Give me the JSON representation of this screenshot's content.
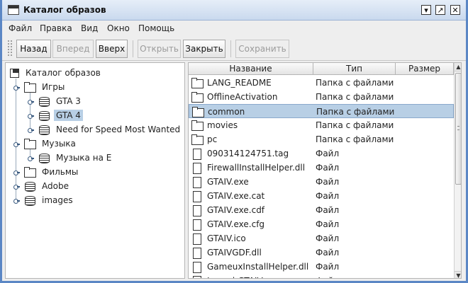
{
  "window": {
    "title": "Каталог образов",
    "accent_color": "#5b87c5",
    "controls": [
      "minimize-icon",
      "maximize-icon",
      "close-icon"
    ]
  },
  "menu": {
    "items": [
      "Файл",
      "Правка",
      "Вид",
      "Окно",
      "Помощь"
    ]
  },
  "toolbar": {
    "buttons": [
      {
        "label": "Назад",
        "enabled": true
      },
      {
        "label": "Вперед",
        "enabled": false
      },
      {
        "label": "Вверх",
        "enabled": true
      },
      {
        "label": "Открыть",
        "enabled": false
      },
      {
        "label": "Закрыть",
        "enabled": true
      },
      {
        "label": "Сохранить",
        "enabled": false
      }
    ]
  },
  "tree": {
    "root": {
      "label": "Каталог образов",
      "icon": "floppy-icon"
    },
    "nodes": [
      {
        "label": "Игры",
        "icon": "folder-icon",
        "level": 1
      },
      {
        "label": "GTA 3",
        "icon": "disk-icon",
        "level": 2
      },
      {
        "label": "GTA 4",
        "icon": "disk-icon",
        "level": 2,
        "selected": true
      },
      {
        "label": "Need for Speed Most Wanted",
        "icon": "disk-icon",
        "level": 2
      },
      {
        "label": "Музыка",
        "icon": "folder-icon",
        "level": 1
      },
      {
        "label": "Музыка на E",
        "icon": "disk-icon",
        "level": 2
      },
      {
        "label": "Фильмы",
        "icon": "folder-icon",
        "level": 1
      },
      {
        "label": "Adobe",
        "icon": "disk-icon",
        "level": 1
      },
      {
        "label": "images",
        "icon": "disk-icon",
        "level": 1
      }
    ]
  },
  "table": {
    "columns": [
      "Название",
      "Тип",
      "Размер"
    ],
    "rows": [
      {
        "name": "LANG_README",
        "type": "Папка с файлами",
        "size": "",
        "icon": "folder-icon"
      },
      {
        "name": "OfflineActivation",
        "type": "Папка с файлами",
        "size": "",
        "icon": "folder-icon"
      },
      {
        "name": "common",
        "type": "Папка с файлами",
        "size": "",
        "icon": "folder-icon",
        "selected": true
      },
      {
        "name": "movies",
        "type": "Папка с файлами",
        "size": "",
        "icon": "folder-icon"
      },
      {
        "name": "pc",
        "type": "Папка с файлами",
        "size": "",
        "icon": "folder-icon"
      },
      {
        "name": "090314124751.tag",
        "type": "Файл",
        "size": "",
        "icon": "file-icon"
      },
      {
        "name": "FirewallInstallHelper.dll",
        "type": "Файл",
        "size": "",
        "icon": "file-icon"
      },
      {
        "name": "GTAIV.exe",
        "type": "Файл",
        "size": "",
        "icon": "file-icon"
      },
      {
        "name": "GTAIV.exe.cat",
        "type": "Файл",
        "size": "",
        "icon": "file-icon"
      },
      {
        "name": "GTAIV.exe.cdf",
        "type": "Файл",
        "size": "",
        "icon": "file-icon"
      },
      {
        "name": "GTAIV.exe.cfg",
        "type": "Файл",
        "size": "",
        "icon": "file-icon"
      },
      {
        "name": "GTAIV.ico",
        "type": "Файл",
        "size": "",
        "icon": "file-icon"
      },
      {
        "name": "GTAIVGDF.dll",
        "type": "Файл",
        "size": "",
        "icon": "file-icon"
      },
      {
        "name": "GameuxInstallHelper.dll",
        "type": "Файл",
        "size": "",
        "icon": "file-icon"
      },
      {
        "name": "LaunchGTAIV.exe",
        "type": "Файл",
        "size": "",
        "icon": "file-icon"
      }
    ]
  }
}
